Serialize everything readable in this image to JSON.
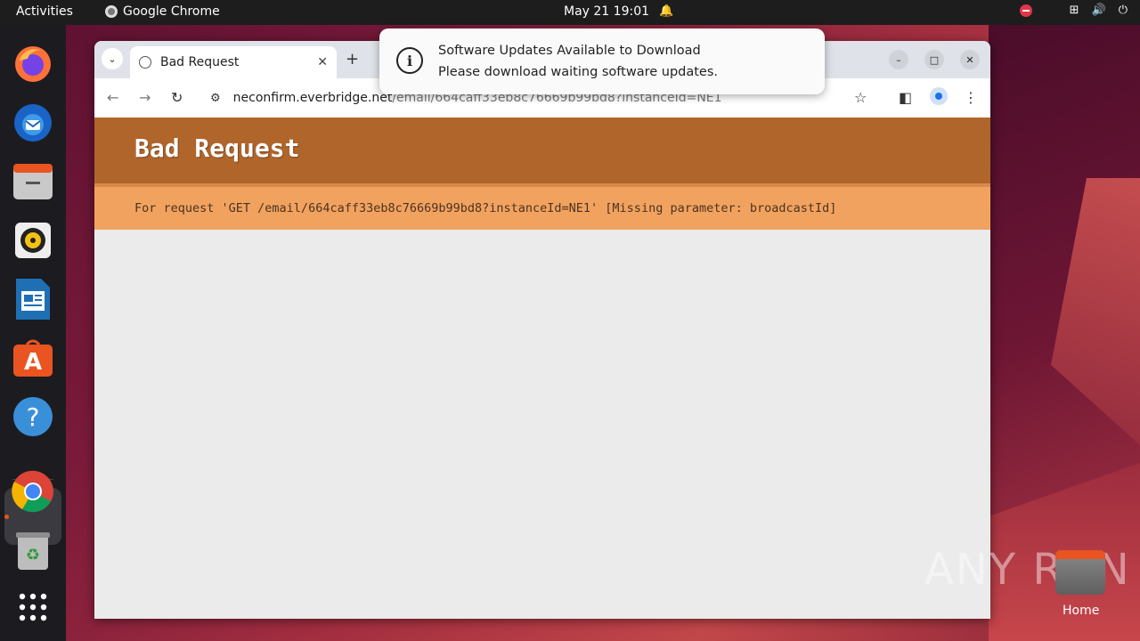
{
  "topbar": {
    "activities": "Activities",
    "app_name": "Google Chrome",
    "clock": "May 21  19:01"
  },
  "dock": {
    "items": [
      "firefox-icon",
      "thunderbird-icon",
      "files-icon",
      "rhythmbox-icon",
      "libreoffice-writer-icon",
      "app-center-icon",
      "help-icon",
      "chrome-icon",
      "trash-icon",
      "show-apps-icon"
    ]
  },
  "browser": {
    "tab_title": "Bad Request",
    "url_host": "neconfirm.everbridge.net",
    "url_path": "/email/664caff33eb8c76669b99bd8?instanceId=NE1"
  },
  "page": {
    "heading": "Bad Request",
    "message": "For request 'GET /email/664caff33eb8c76669b99bd8?instanceId=NE1' [Missing parameter: broadcastId]",
    "header_color": "#b0652b",
    "message_bg": "#f2a25f"
  },
  "notification": {
    "title": "Software Updates Available to Download",
    "body": "Please download waiting software updates."
  },
  "desktop": {
    "watermark": "ANY RUN",
    "home_label": "Home"
  }
}
